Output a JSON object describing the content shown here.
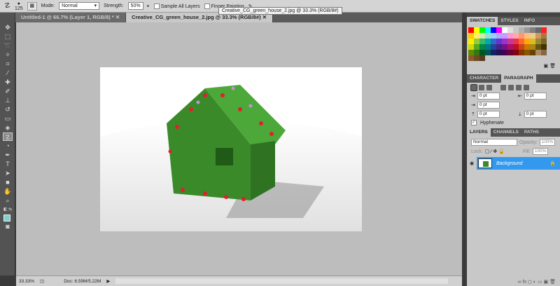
{
  "options_bar": {
    "brush_size": "125",
    "mode_label": "Mode:",
    "mode_value": "Normal",
    "strength_label": "Strength:",
    "strength_value": "50%",
    "sample_all_layers": "Sample All Layers",
    "finger_painting": "Finger Painting"
  },
  "tooltip": "Creative_CG_green_house_2.jpg @ 33.3% (RGB/8#)",
  "tabs": [
    {
      "label": "Untitled-1 @ 66.7% (Layer 1, RGB/8) *",
      "active": false
    },
    {
      "label": "Creative_CG_green_house_2.jpg @ 33.3% (RGB/8#)",
      "active": true
    }
  ],
  "status": {
    "zoom": "33.33%",
    "doc": "Doc: 6.59M/5.22M"
  },
  "swatches_panel": {
    "tabs": [
      "SWATCHES",
      "STYLES",
      "INFO"
    ],
    "colors": [
      "#ff0000",
      "#ffff00",
      "#00ff00",
      "#00ffff",
      "#0000ff",
      "#ff00ff",
      "#ffffff",
      "#e0e0e0",
      "#c8c8c8",
      "#b0b0b0",
      "#989898",
      "#808080",
      "#686868",
      "#ff2020",
      "#ffcc00",
      "#ffee66",
      "#cceeaa",
      "#99ddcc",
      "#99ccff",
      "#aaaaff",
      "#cc99ff",
      "#ff99cc",
      "#ffaaaa",
      "#ff9966",
      "#ffbb88",
      "#eecc88",
      "#cc9966",
      "#aa7744",
      "#ffee00",
      "#99cc33",
      "#33bb66",
      "#00aaaa",
      "#3366cc",
      "#6633cc",
      "#9933cc",
      "#cc3399",
      "#ee3344",
      "#ff6633",
      "#ffaa00",
      "#ddbb22",
      "#998833",
      "#776622",
      "#ccdd00",
      "#55aa22",
      "#008844",
      "#007788",
      "#224499",
      "#442288",
      "#771188",
      "#aa1166",
      "#bb1122",
      "#cc4411",
      "#cc7700",
      "#aa8811",
      "#665511",
      "#443300",
      "#668800",
      "#337711",
      "#005522",
      "#005555",
      "#112266",
      "#221155",
      "#440055",
      "#660033",
      "#880011",
      "#883300",
      "#885500",
      "#664400",
      "#aa8866",
      "#886644",
      "#8a5a2a",
      "#6e4a22",
      "#5a3a1a"
    ]
  },
  "paragraph_panel": {
    "tabs": [
      "CHARACTER",
      "PARAGRAPH"
    ],
    "indent_left": "0 pt",
    "indent_right": "0 pt",
    "first_line": "0 pt",
    "space_before": "0 pt",
    "space_after": "0 pt",
    "hyphenate": "Hyphenate"
  },
  "layers_panel": {
    "tabs": [
      "LAYERS",
      "CHANNELS",
      "PATHS"
    ],
    "blend_mode": "Normal",
    "opacity_label": "Opacity:",
    "opacity": "100%",
    "lock_label": "Lock:",
    "fill_label": "Fill:",
    "fill": "100%",
    "layers": [
      {
        "name": "Background",
        "selected": true,
        "locked": true
      }
    ]
  },
  "colors": {
    "selection": "#3399ee",
    "foreground": "#7fd0d0"
  }
}
